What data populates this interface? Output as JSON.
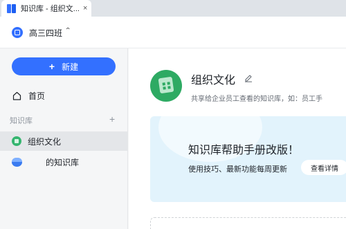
{
  "tab": {
    "title": "知识库 - 组织文...",
    "close": "×"
  },
  "header": {
    "team_name": "高三四班",
    "caret": "⌃"
  },
  "sidebar": {
    "new_button": {
      "plus": "+",
      "label": "新建"
    },
    "home_label": "首页",
    "section_label": "知识库",
    "section_add": "+",
    "items": [
      {
        "label": "组织文化",
        "active": true
      },
      {
        "label": "的知识库",
        "active": false
      }
    ]
  },
  "main": {
    "title": "组织文化",
    "description": "共享给企业员工查看的知识库，如：员工手",
    "banner": {
      "title": "知识库帮助手册改版！",
      "subtitle": "使用技巧、最新功能每周更新",
      "button": "查看详情"
    }
  },
  "colors": {
    "accent": "#3370ff",
    "kb_green": "#2eaa63",
    "banner_bg": "#e2f3fc"
  }
}
